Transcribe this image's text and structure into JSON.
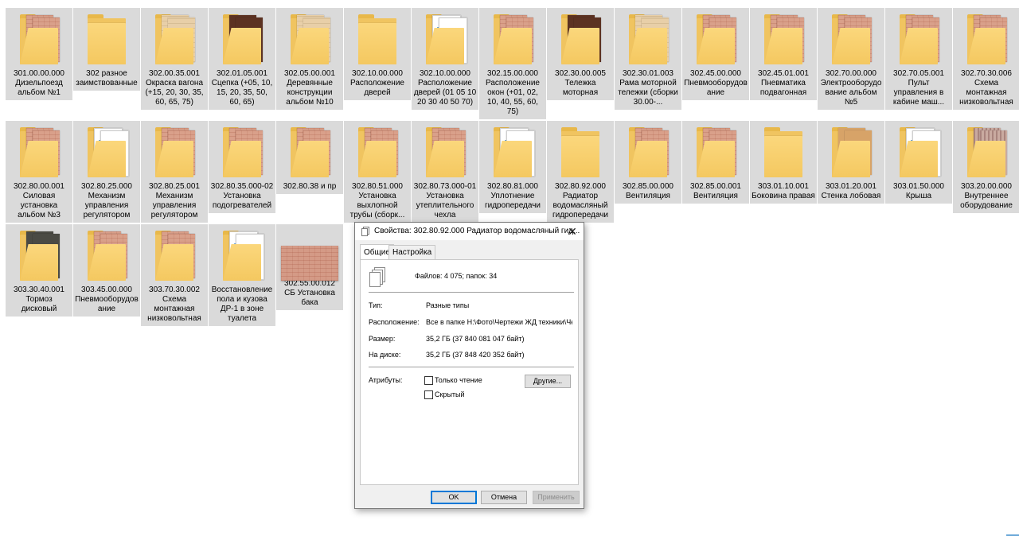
{
  "items": [
    {
      "label": "301.00.00.000 Дизельпоезд альбом №1",
      "thumb": "folder-docs",
      "doc": "pink"
    },
    {
      "label": "302 разное заимствованные",
      "thumb": "folder-empty"
    },
    {
      "label": "302.00.35.001 Окраска вагона (+15, 20, 30, 35, 60, 65, 75)",
      "thumb": "folder-docs",
      "doc": "beige"
    },
    {
      "label": "302.01.05.001 Сцепка (+05, 10, 15, 20, 35, 50, 60, 65)",
      "thumb": "folder-docs",
      "doc": "brown"
    },
    {
      "label": "302.05.00.001 Деревянные конструкции альбом №10",
      "thumb": "folder-docs",
      "doc": "beige"
    },
    {
      "label": "302.10.00.000 Расположение дверей",
      "thumb": "folder-empty"
    },
    {
      "label": "302.10.00.000 Расположение дверей (01 05 10 20 30 40 50 70)",
      "thumb": "folder-docs",
      "doc": "photo"
    },
    {
      "label": "302.15.00.000 Расположение окон (+01, 02, 10, 40, 55, 60, 75)",
      "thumb": "folder-docs",
      "doc": "pink"
    },
    {
      "label": "302.30.00.005 Тележка моторная",
      "thumb": "folder-docs",
      "doc": "brown"
    },
    {
      "label": "302.30.01.003 Рама моторной тележки (сборки 30.00-...",
      "thumb": "folder-docs",
      "doc": "beige"
    },
    {
      "label": "302.45.00.000 Пневмооборудование",
      "thumb": "folder-docs",
      "doc": "pink"
    },
    {
      "label": "302.45.01.001 Пневматика подвагонная",
      "thumb": "folder-docs",
      "doc": "pink"
    },
    {
      "label": "302.70.00.000 Электрооборудование альбом №5",
      "thumb": "folder-docs",
      "doc": "pink"
    },
    {
      "label": "302.70.05.001 Пульт управления в кабине маш...",
      "thumb": "folder-docs",
      "doc": "pink"
    },
    {
      "label": "302.70.30.006 Схема монтажная низковольтная",
      "thumb": "folder-docs",
      "doc": "pink"
    },
    {
      "label": "302.80.00.001 Силовая установка альбом №3",
      "thumb": "folder-docs",
      "doc": "pink"
    },
    {
      "label": "302.80.25.000 Механизм управления регулятором",
      "thumb": "folder-docs",
      "doc": "photo"
    },
    {
      "label": "302.80.25.001 Механизм управления регулятором",
      "thumb": "folder-docs",
      "doc": "pink"
    },
    {
      "label": "302.80.35.000-02 Установка подогревателей",
      "thumb": "folder-docs",
      "doc": "pink"
    },
    {
      "label": "302.80.38 и пр",
      "thumb": "folder-docs",
      "doc": "pink"
    },
    {
      "label": "302.80.51.000 Установка выхлопной трубы (сборк...",
      "thumb": "folder-docs",
      "doc": "pink"
    },
    {
      "label": "302.80.73.000-01 Установка утеплительного чехла",
      "thumb": "folder-docs",
      "doc": "pink"
    },
    {
      "label": "302.80.81.000 Уплотнение гидропередачи",
      "thumb": "folder-docs",
      "doc": "photo"
    },
    {
      "label": "302.80.92.000 Радиатор водомасляный гидропередачи",
      "thumb": "folder-empty"
    },
    {
      "label": "302.85.00.000 Вентиляция",
      "thumb": "folder-docs",
      "doc": "pink"
    },
    {
      "label": "302.85.00.001 Вентиляция",
      "thumb": "folder-docs",
      "doc": "pink"
    },
    {
      "label": "303.01.10.001 Боковина правая",
      "thumb": "folder-empty"
    },
    {
      "label": "303.01.20.001 Стенка лобовая",
      "thumb": "folder-docs",
      "doc": "wood"
    },
    {
      "label": "303.01.50.000 Крыша",
      "thumb": "folder-docs",
      "doc": "photo"
    },
    {
      "label": "303.20.00.000 Внутреннее оборудование",
      "thumb": "folder-striped",
      "doc": "pink"
    },
    {
      "label": "303.30.40.001 Тормоз дисковый",
      "thumb": "folder-docs",
      "doc": "dark"
    },
    {
      "label": "303.45.00.000 Пневмооборудование",
      "thumb": "folder-docs",
      "doc": "pink"
    },
    {
      "label": "303.70.30.002 Схема монтажная низковольтная",
      "thumb": "folder-docs",
      "doc": "pink"
    },
    {
      "label": "Восстановление пола и кузова ДР-1 в зоне туалета",
      "thumb": "folder-docs",
      "doc": "photo"
    },
    {
      "label": "302.55.00.012 СБ Установка бака",
      "thumb": "image"
    }
  ],
  "dialog": {
    "title": "Свойства: 302.80.92.000 Радиатор водомасляный гид...",
    "close": "✕",
    "tabs": [
      "Общие",
      "Настройка"
    ],
    "summary": "Файлов: 4 075; папок: 34",
    "type_label": "Тип:",
    "type_value": "Разные типы",
    "location_label": "Расположение:",
    "location_value": "Все в папке H:\\Фото\\Чертежи ЖД техники\\Че",
    "size_label": "Размер:",
    "size_value": "35,2 ГБ (37 840 081 047 байт)",
    "disk_label": "На диске:",
    "disk_value": "35,2 ГБ (37 848 420 352 байт)",
    "attributes_label": "Атрибуты:",
    "readonly_label": "Только чтение",
    "hidden_label": "Скрытый",
    "other_button": "Другие...",
    "ok": "OK",
    "cancel": "Отмена",
    "apply": "Применить"
  }
}
